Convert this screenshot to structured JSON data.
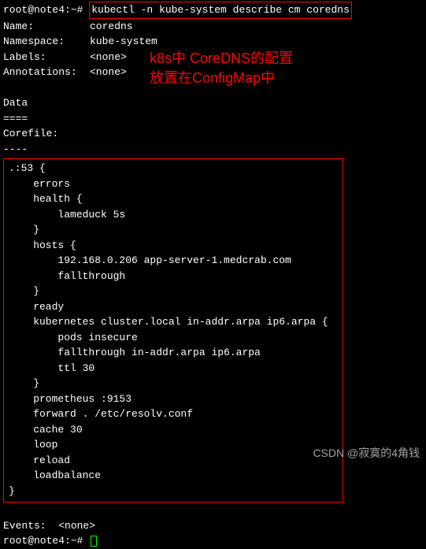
{
  "prompt1": {
    "prefix": "root@note4:~# ",
    "command": "kubectl -n kube-system describe cm coredns"
  },
  "fields": {
    "name": {
      "label": "Name:",
      "value": "coredns"
    },
    "namespace": {
      "label": "Namespace:",
      "value": "kube-system"
    },
    "labels": {
      "label": "Labels:",
      "value": "<none>"
    },
    "annotations": {
      "label": "Annotations:",
      "value": "<none>"
    }
  },
  "annotation": {
    "line1": "k8s中 CoreDNS的配置",
    "line2": "放置在ConfigMap中"
  },
  "spacer1": " ",
  "data_header": "Data",
  "data_sep": "====",
  "corefile_header": "Corefile:",
  "corefile_sep": "----",
  "corefile": {
    "l01": ".:53 {",
    "l02": "    errors",
    "l03": "    health {",
    "l04": "        lameduck 5s",
    "l05": "    }",
    "l06": "    hosts {",
    "l07": "        192.168.0.206 app-server-1.medcrab.com",
    "l08": "        fallthrough",
    "l09": "    }",
    "l10": "    ready",
    "l11": "    kubernetes cluster.local in-addr.arpa ip6.arpa {",
    "l12": "        pods insecure",
    "l13": "        fallthrough in-addr.arpa ip6.arpa",
    "l14": "        ttl 30",
    "l15": "    }",
    "l16": "    prometheus :9153",
    "l17": "    forward . /etc/resolv.conf",
    "l18": "    cache 30",
    "l19": "    loop",
    "l20": "    reload",
    "l21": "    loadbalance",
    "l22": "}"
  },
  "spacer2": " ",
  "events": "Events:  <none>",
  "prompt2": {
    "prefix": "root@note4:~# "
  },
  "watermark": "CSDN @寂寞的4角钱"
}
